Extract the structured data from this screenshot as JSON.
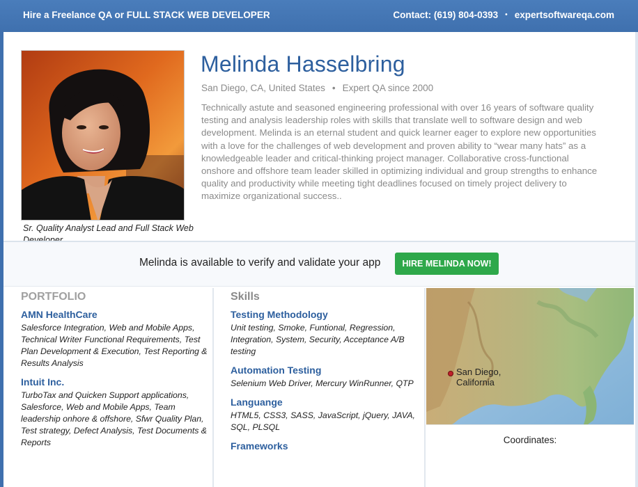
{
  "topbar": {
    "tagline": "Hire a Freelance QA or FULL STACK WEB DEVELOPER",
    "contact": "Contact: (619) 804-0393",
    "separator": "•",
    "site": "expertsoftwareqa.com"
  },
  "profile": {
    "name": "Melinda Hasselbring",
    "location": "San Diego, CA, United States",
    "meta_separator": "•",
    "experience": "Expert QA since 2000",
    "bio": "Technically astute and seasoned engineering professional with over 16 years of software quality testing and analysis leadership roles with skills that translate well to software design and web development. Melinda is an eternal student and quick learner eager to explore new opportunities with a love for the challenges of web development and proven ability to “wear many hats” as a knowledgeable leader and critical-thinking project manager. Collaborative cross-functional onshore and offshore team leader skilled in optimizing individual and group strengths to enhance quality and productivity while meeting tight deadlines focused on timely project delivery to maximize organizational success..",
    "photo_caption": "Sr. Quality Analyst Lead and Full Stack Web Developer"
  },
  "availability": {
    "text": "Melinda is available to verify and validate your app",
    "button": "HIRE MELINDA NOW!",
    "button_color": "#2ea84a"
  },
  "portfolio": {
    "heading": "PORTFOLIO",
    "items": [
      {
        "title": "AMN HealthCare",
        "desc": "Salesforce Integration, Web and Mobile Apps, Technical Writer Functional Requirements, Test Plan Development & Execution, Test Reporting & Results Analysis"
      },
      {
        "title": "Intuit Inc.",
        "desc": "TurboTax and Quicken Support applications, Salesforce, Web and Mobile Apps, Team leadership onhore & offshore, Sfwr Quality Plan, Test strategy, Defect Analysis, Test Documents & Reports"
      }
    ]
  },
  "skills": {
    "heading": "Skills",
    "items": [
      {
        "title": "Testing Methodology",
        "desc": "Unit testing, Smoke, Funtional, Regression, Integration, System, Security, Acceptance A/B testing"
      },
      {
        "title": "Automation Testing",
        "desc": "Selenium Web Driver, Mercury WinRunner, QTP"
      },
      {
        "title": "Languange",
        "desc": "HTML5, CSS3, SASS, JavaScript, jQuery, JAVA, SQL, PLSQL"
      },
      {
        "title": "Frameworks",
        "desc": ""
      }
    ]
  },
  "map": {
    "label_line1": "San Diego,",
    "label_line2": "California",
    "coords_label": "Coordinates:"
  },
  "colors": {
    "brand_blue": "#3f70ae",
    "link_blue": "#2d5f9e",
    "muted_gray": "#8a8a8a"
  }
}
